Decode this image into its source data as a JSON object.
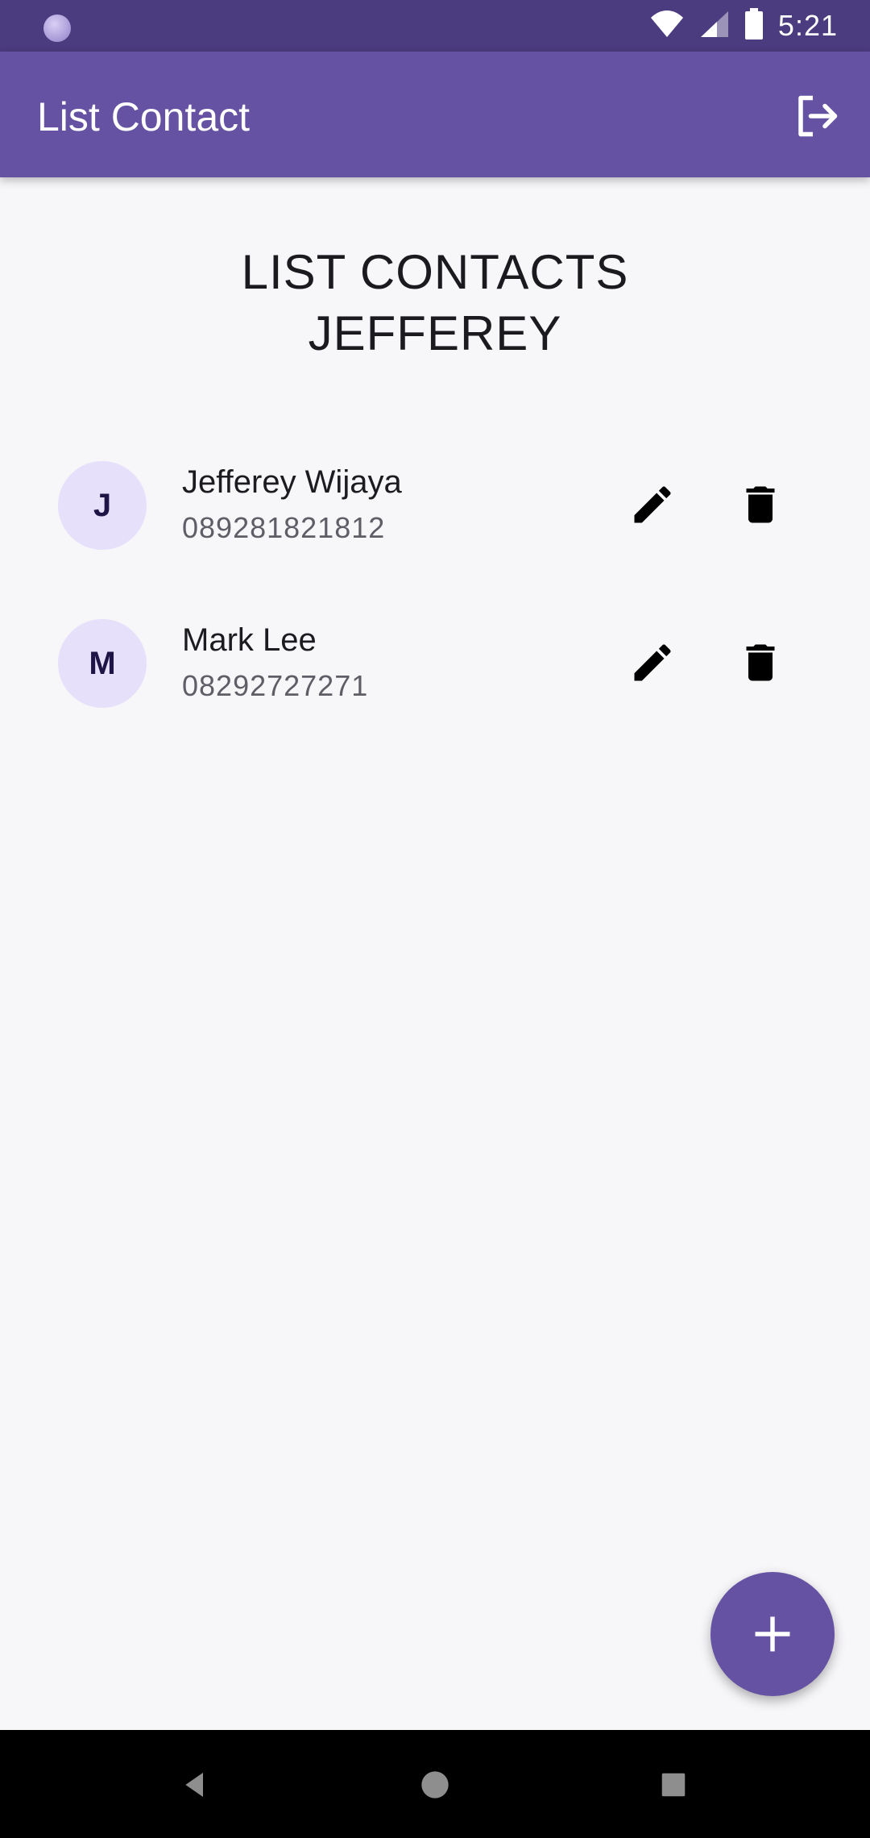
{
  "status_bar": {
    "time": "5:21",
    "icons": [
      "notification-dot-icon",
      "wifi-icon",
      "signal-icon",
      "battery-icon"
    ]
  },
  "app_bar": {
    "title": "List Contact",
    "action_icon": "logout-icon"
  },
  "page": {
    "heading_line1": "LIST CONTACTS",
    "heading_line2": "JEFFEREY"
  },
  "contacts": [
    {
      "initial": "J",
      "name": "Jefferey Wijaya",
      "phone": "089281821812"
    },
    {
      "initial": "M",
      "name": "Mark Lee",
      "phone": "08292727271"
    }
  ],
  "fab": {
    "icon": "add-icon"
  },
  "nav_bar": {
    "icons": [
      "back-icon",
      "home-icon",
      "recents-icon"
    ]
  },
  "colors": {
    "primary": "#6552a3",
    "status_bar": "#4b3b7f",
    "avatar_bg": "#e6e0fb",
    "background": "#f7f6f9"
  }
}
